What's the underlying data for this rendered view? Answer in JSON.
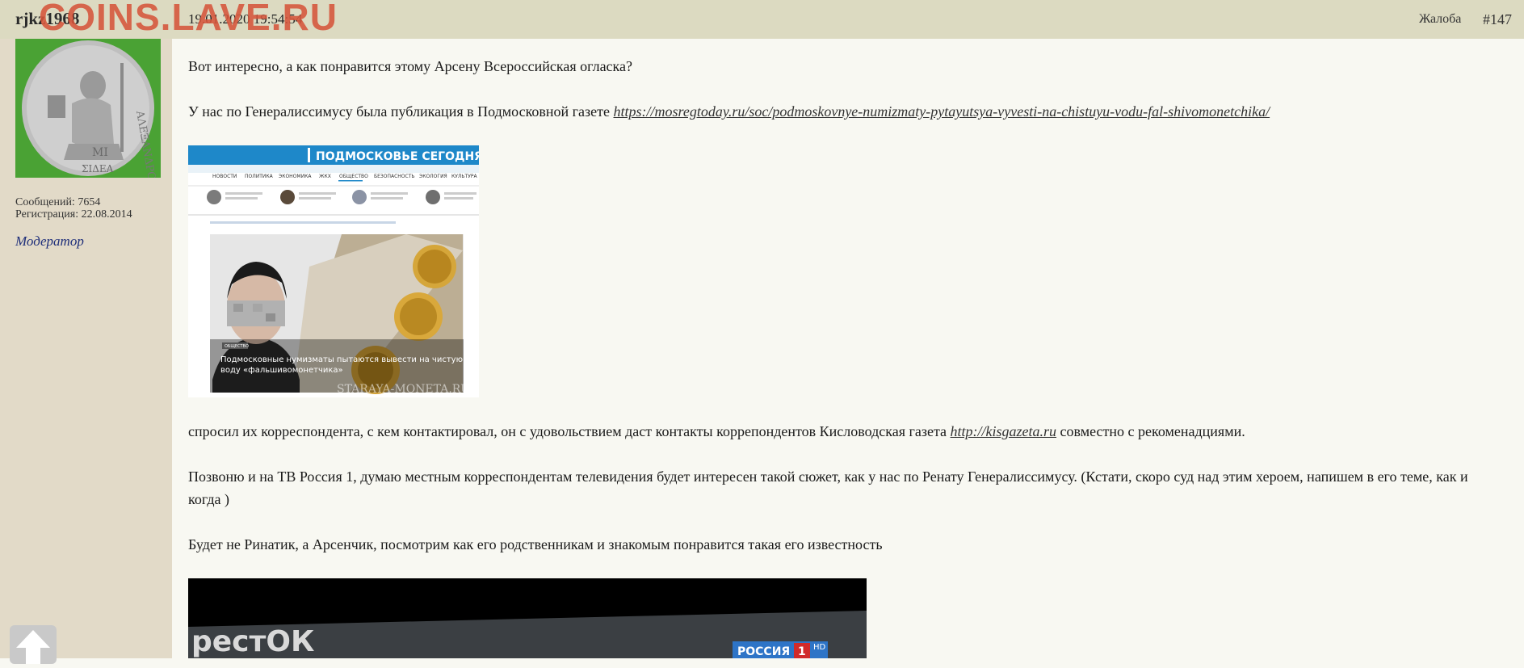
{
  "header": {
    "username": "rjkz1968",
    "date": "19.01.2020 19:54:54",
    "watermark": "COINS.LAVE.RU",
    "report_label": "Жалоба",
    "post_number": "#147"
  },
  "user": {
    "posts_count": "Сообщений: 7654",
    "registration": "Регистрация: 22.08.2014",
    "role": "Модератор"
  },
  "post": {
    "p1": "Вот интересно, а как понравится этому Арсену Всероссийская огласка?",
    "p2_text": "У нас по Генералиссимусу была публикация в Подмосковной газете ",
    "p2_link": "https://mosregtoday.ru/soc/podmoskovnye-numizmaty-pytayutsya-vyvesti-na-chistuyu-vodu-fal-shivomonetchika/",
    "p3_text_before": "спросил их корреспондента, с кем контактировал, он с удовольствием даст контакты коррепондентов Кисловодская газета ",
    "p3_link": "http://kisgazeta.ru",
    "p3_text_after": " совместно с рекоменадциями.",
    "p4": "Позвоню и на ТВ Россия 1, думаю местным корреспондентам телевидения будет интересен такой сюжет, как у нас по Ренату Генералиссимусу. (Кстати, скоро суд над этим хероем, напишем в его теме, как и когда )",
    "p5": "Будет не Ринатик, а Арсенчик, посмотрим как его родственникам и знакомым понравится такая его известность"
  },
  "news_image": {
    "site_name": "ПОДМОСКОВЬЕ СЕГОДНЯ",
    "nav": [
      "НОВОСТИ",
      "ПОЛИТИКА",
      "ЭКОНОМИКА",
      "ЖКХ",
      "ОБЩЕСТВО",
      "БЕЗОПАСНОСТЬ",
      "ЭКОЛОГИЯ",
      "КУЛЬТУРА"
    ],
    "tag": "ОБЩЕСТВО",
    "headline_1": "Подмосковные нумизматы пытаются вывести на чистую",
    "headline_2": "воду «фальшивомонетчика»",
    "watermark": "STARAYA-MONETA.RU"
  },
  "video_image": {
    "channel": "РОССИЯ",
    "channel_num": "1",
    "hd": "HD",
    "text_left": "рестОК"
  },
  "colors": {
    "header_bg": "#dcdac1",
    "sidebar_bg": "#e2dac8",
    "content_bg": "#f8f8f2",
    "watermark": "#d6553b",
    "role": "#1f2f7a"
  }
}
